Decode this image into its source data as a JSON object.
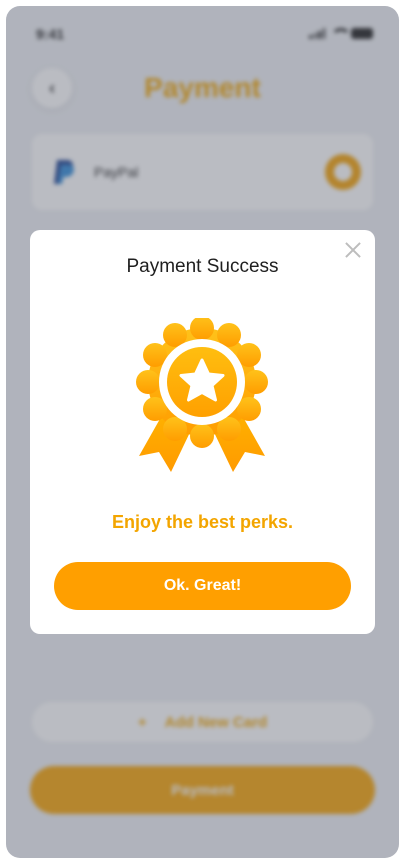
{
  "status_bar": {
    "time": "9:41"
  },
  "header": {
    "title": "Payment",
    "back_icon": "chevron-left-icon"
  },
  "payment_method": {
    "label": "PayPal",
    "icon": "paypal-icon",
    "selected": true
  },
  "add_card": {
    "label": "Add New Card",
    "icon": "plus-icon"
  },
  "pay_button": {
    "label": "Payment"
  },
  "modal": {
    "title": "Payment Success",
    "badge_icon": "award-ribbon-star-icon",
    "message": "Enjoy the best perks.",
    "button_label": "Ok. Great!",
    "close_icon": "close-icon"
  },
  "colors": {
    "accent": "#f6a200",
    "accent_text": "#f3a500",
    "overlay": "#5a5f6e",
    "modal_bg": "#ffffff"
  }
}
